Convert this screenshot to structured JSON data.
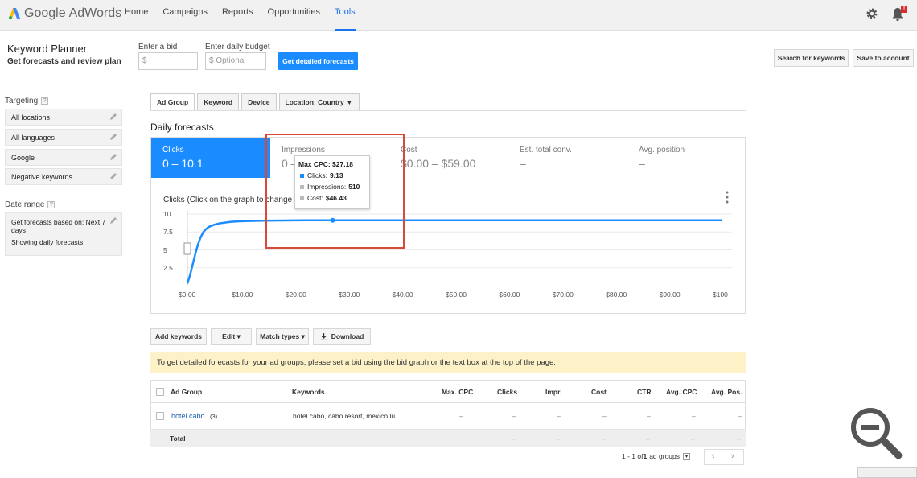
{
  "app": {
    "logo_google": "Google",
    "logo_product": "AdWords"
  },
  "nav": [
    {
      "label": "Home"
    },
    {
      "label": "Campaigns"
    },
    {
      "label": "Reports"
    },
    {
      "label": "Opportunities"
    },
    {
      "label": "Tools",
      "active": true
    }
  ],
  "notification_badge": "!",
  "header": {
    "title": "Keyword Planner",
    "subtitle": "Get forecasts and review plan",
    "bid_label": "Enter a bid",
    "bid_placeholder": "$",
    "budget_label": "Enter daily budget",
    "budget_placeholder": "$  Optional",
    "get_forecasts": "Get detailed forecasts",
    "search_keywords": "Search for keywords",
    "save_account": "Save to account"
  },
  "sidebar": {
    "targeting_label": "Targeting",
    "items": [
      {
        "label": "All locations"
      },
      {
        "label": "All languages"
      },
      {
        "label": "Google"
      },
      {
        "label": "Negative keywords"
      }
    ],
    "date_range_label": "Date range",
    "date_line1": "Get forecasts based on: Next 7 days",
    "date_line2": "Showing daily forecasts"
  },
  "tabs": [
    {
      "label": "Ad Group",
      "active": true
    },
    {
      "label": "Keyword"
    },
    {
      "label": "Device"
    },
    {
      "label": "Location: Country ▼"
    }
  ],
  "daily_title": "Daily forecasts",
  "metrics": [
    {
      "label": "Clicks",
      "value": "0 – 10.1",
      "active": true
    },
    {
      "label": "Impressions",
      "value": "0 –"
    },
    {
      "label": "Cost",
      "value": "$0.00 – $59.00"
    },
    {
      "label": "Est. total conv.",
      "value": "–"
    },
    {
      "label": "Avg. position",
      "value": "–"
    }
  ],
  "chart_title": "Clicks (Click on the graph to change y",
  "tooltip": {
    "title": "Max CPC: $27.18",
    "rows": [
      {
        "label": "Clicks: ",
        "value": "9.13",
        "color": "#1a8cff"
      },
      {
        "label": "Impressions: ",
        "value": "510",
        "color": "#bbbbbb"
      },
      {
        "label": "Cost: ",
        "value": "$46.43",
        "color": "#bbbbbb"
      }
    ]
  },
  "chart_data": {
    "type": "line",
    "xlabel": "",
    "ylabel": "",
    "x_ticks": [
      "$0.00",
      "$10.00",
      "$20.00",
      "$30.00",
      "$40.00",
      "$50.00",
      "$60.00",
      "$70.00",
      "$80.00",
      "$90.00",
      "$100"
    ],
    "y_ticks": [
      "10",
      "7.5",
      "5",
      "2.5"
    ],
    "xlim": [
      0,
      100
    ],
    "ylim": [
      0,
      10.5
    ],
    "series": [
      {
        "x": [
          0,
          0.5,
          1,
          1.5,
          2,
          2.5,
          3,
          3.5,
          4,
          5,
          6,
          8,
          10,
          14,
          20,
          27.18,
          40,
          60,
          80,
          100
        ],
        "y": [
          0.3,
          1.5,
          3.0,
          4.5,
          5.8,
          6.8,
          7.5,
          7.9,
          8.2,
          8.5,
          8.7,
          8.9,
          9.0,
          9.08,
          9.12,
          9.13,
          9.13,
          9.13,
          9.13,
          9.13
        ],
        "color": "#1a8cff"
      }
    ],
    "highlight": {
      "x": 27.18,
      "y": 9.13
    }
  },
  "toolbar": {
    "add_keywords": "Add keywords",
    "edit": "Edit ▾",
    "match_types": "Match types ▾",
    "download": "Download"
  },
  "notice": "To get detailed forecasts for your ad groups, please set a bid using the bid graph or the text box at the top of the page.",
  "table": {
    "headers": [
      "Ad Group",
      "Keywords",
      "Max. CPC",
      "Clicks",
      "Impr.",
      "Cost",
      "CTR",
      "Avg. CPC",
      "Avg. Pos."
    ],
    "row": {
      "ad_group": "hotel cabo",
      "count": "(3)",
      "keywords": "hotel cabo, cabo resort, mexico lu...",
      "cells": [
        "–",
        "–",
        "–",
        "–",
        "–",
        "–",
        "–"
      ]
    },
    "total": {
      "label": "Total",
      "cells": [
        "–",
        "–",
        "–",
        "–",
        "–",
        "–"
      ]
    }
  },
  "pager": {
    "text_pre": "1 - 1 of ",
    "text_bold": "1",
    "text_post": " ad groups"
  }
}
